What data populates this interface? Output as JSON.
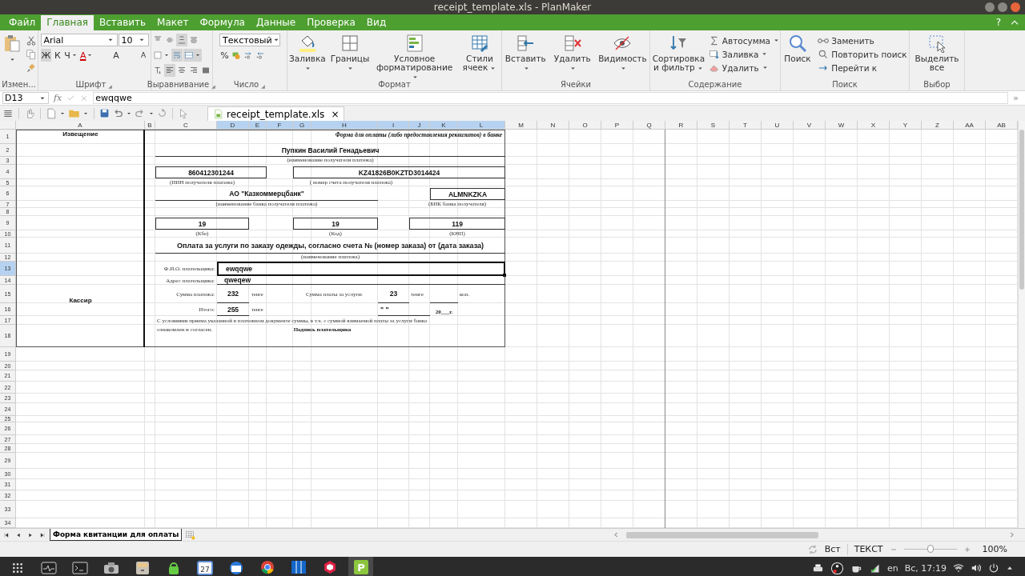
{
  "window": {
    "title": "receipt_template.xls - PlanMaker"
  },
  "menu_tabs": [
    {
      "label": "Файл",
      "selected": false
    },
    {
      "label": "Главная",
      "selected": true
    },
    {
      "label": "Вставить",
      "selected": false
    },
    {
      "label": "Макет",
      "selected": false
    },
    {
      "label": "Формула",
      "selected": false
    },
    {
      "label": "Данные",
      "selected": false
    },
    {
      "label": "Проверка",
      "selected": false
    },
    {
      "label": "Вид",
      "selected": false
    }
  ],
  "help_button": "?",
  "ribbon": [
    {
      "title": "Измен...",
      "launcher": false,
      "items": [
        {
          "kind": "large",
          "dropdown": true
        },
        {
          "kind": "stack",
          "items": [
            {
              "kind": "small",
              "dropdown": false
            },
            {
              "kind": "small",
              "dropdown": false
            },
            {
              "kind": "small",
              "dropdown": false
            }
          ]
        }
      ]
    },
    {
      "title": "Шрифт",
      "launcher": true,
      "top": [
        {
          "kind": "font-select",
          "value": "Arial"
        },
        {
          "kind": "size-select",
          "value": "10"
        }
      ],
      "bottom": [
        {
          "kind": "toggle",
          "label": "Ж",
          "selected": true,
          "dropdown": false
        },
        {
          "kind": "toggle",
          "label": "К",
          "selected": false,
          "dropdown": false
        },
        {
          "kind": "toggle",
          "label": "Ч",
          "selected": false,
          "dropdown": true
        },
        {
          "kind": "color",
          "label": "A",
          "selected": false,
          "dropdown": true
        },
        {
          "kind": "grow",
          "label": "A",
          "selected": false,
          "dropdown": false
        },
        {
          "kind": "shrink",
          "label": "A",
          "selected": false,
          "dropdown": false
        }
      ]
    },
    {
      "title": "Выравнивание",
      "launcher": true,
      "top": [
        {
          "kind": "icon",
          "selected": false,
          "dropdown": false
        },
        {
          "kind": "icon",
          "selected": false,
          "dropdown": false
        },
        {
          "kind": "icon",
          "selected": true,
          "dropdown": false
        },
        {
          "kind": "icon",
          "selected": false,
          "dropdown": false
        }
      ],
      "middle": [
        {
          "kind": "icon",
          "selected": false,
          "dropdown": true
        },
        {
          "kind": "icon",
          "selected": true,
          "dropdown": false
        },
        {
          "kind": "icon",
          "selected": true,
          "dropdown": true
        }
      ],
      "bottom": [
        {
          "kind": "icon",
          "selected": false,
          "dropdown": false
        },
        {
          "kind": "icon",
          "selected": true,
          "dropdown": false
        },
        {
          "kind": "icon",
          "selected": false,
          "dropdown": false
        },
        {
          "kind": "icon",
          "selected": false,
          "dropdown": false
        },
        {
          "kind": "icon",
          "selected": false,
          "dropdown": false
        }
      ]
    },
    {
      "title": "Число",
      "launcher": true,
      "top": [
        {
          "kind": "format-select",
          "value": "Текстовый"
        }
      ],
      "bottom": [
        {
          "kind": "toggle",
          "label": "%",
          "selected": false,
          "dropdown": false
        },
        {
          "kind": "icon",
          "selected": false,
          "dropdown": false
        },
        {
          "kind": "icon",
          "selected": false,
          "dropdown": false
        },
        {
          "kind": "icon",
          "selected": false,
          "dropdown": false
        }
      ]
    },
    {
      "title": "Формат",
      "launcher": false,
      "items": [
        {
          "kind": "large",
          "label": "Заливка",
          "dropdown": true
        },
        {
          "kind": "large",
          "label": "Границы",
          "dropdown": true
        },
        {
          "kind": "large",
          "label": "Условное форматирование",
          "dropdown": true
        },
        {
          "kind": "large",
          "label": "Стили ячеек",
          "dropdown": true
        }
      ]
    },
    {
      "title": "Ячейки",
      "launcher": false,
      "items": [
        {
          "kind": "large",
          "label": "Вставить",
          "dropdown": true
        },
        {
          "kind": "large",
          "label": "Удалить",
          "dropdown": true
        },
        {
          "kind": "large",
          "label": "Видимость",
          "dropdown": true
        }
      ]
    },
    {
      "title": "Содержание",
      "launcher": false,
      "items": [
        {
          "kind": "large",
          "label": "Сортировка и фильтр",
          "dropdown": true
        },
        {
          "kind": "stack",
          "items": [
            {
              "kind": "small",
              "label": "Автосумма",
              "dropdown": true
            },
            {
              "kind": "small",
              "label": "Заливка",
              "dropdown": true
            },
            {
              "kind": "small",
              "label": "Удалить",
              "dropdown": true
            }
          ]
        }
      ]
    },
    {
      "title": "Поиск",
      "launcher": false,
      "items": [
        {
          "kind": "large",
          "label": "Поиск",
          "dropdown": false
        },
        {
          "kind": "stack",
          "items": [
            {
              "kind": "small",
              "label": "Заменить",
              "dropdown": false
            },
            {
              "kind": "small",
              "label": "Повторить поиск",
              "dropdown": false
            },
            {
              "kind": "small",
              "label": "Перейти к",
              "dropdown": false
            }
          ]
        }
      ]
    },
    {
      "title": "Выбор",
      "launcher": false,
      "items": [
        {
          "kind": "large",
          "label": "Выделить все",
          "dropdown": false
        }
      ]
    }
  ],
  "formula_bar": {
    "cell_ref": "D13",
    "function_symbol": "fx",
    "value": "ewqqwe",
    "more": "»"
  },
  "document_tab": {
    "label": "receipt_template.xls",
    "close": "×"
  },
  "sheet": {
    "columns": [
      {
        "label": "A",
        "selected": false
      },
      {
        "label": "B",
        "selected": false
      },
      {
        "label": "C",
        "selected": false
      },
      {
        "label": "D",
        "selected": true
      },
      {
        "label": "E",
        "selected": true
      },
      {
        "label": "F",
        "selected": true
      },
      {
        "label": "G",
        "selected": true
      },
      {
        "label": "H",
        "selected": true
      },
      {
        "label": "I",
        "selected": true
      },
      {
        "label": "J",
        "selected": true
      },
      {
        "label": "K",
        "selected": true
      },
      {
        "label": "L",
        "selected": true
      },
      {
        "label": "M",
        "selected": false
      },
      {
        "label": "N",
        "selected": false
      },
      {
        "label": "O",
        "selected": false
      },
      {
        "label": "P",
        "selected": false
      },
      {
        "label": "Q",
        "selected": false
      },
      {
        "label": "R",
        "selected": false
      },
      {
        "label": "S",
        "selected": false
      },
      {
        "label": "T",
        "selected": false
      },
      {
        "label": "U",
        "selected": false
      },
      {
        "label": "V",
        "selected": false
      },
      {
        "label": "W",
        "selected": false
      },
      {
        "label": "X",
        "selected": false
      },
      {
        "label": "Y",
        "selected": false
      },
      {
        "label": "Z",
        "selected": false
      },
      {
        "label": "AA",
        "selected": false
      },
      {
        "label": "AB",
        "selected": false
      }
    ],
    "rows": [
      {
        "label": "1",
        "selected": false
      },
      {
        "label": "2",
        "selected": false
      },
      {
        "label": "3",
        "selected": false
      },
      {
        "label": "4",
        "selected": false
      },
      {
        "label": "5",
        "selected": false
      },
      {
        "label": "6",
        "selected": false
      },
      {
        "label": "7",
        "selected": false
      },
      {
        "label": "8",
        "selected": false
      },
      {
        "label": "9",
        "selected": false
      },
      {
        "label": "10",
        "selected": false
      },
      {
        "label": "11",
        "selected": false
      },
      {
        "label": "12",
        "selected": false
      },
      {
        "label": "13",
        "selected": true
      },
      {
        "label": "14",
        "selected": false
      },
      {
        "label": "15",
        "selected": false
      },
      {
        "label": "16",
        "selected": false
      },
      {
        "label": "17",
        "selected": false
      },
      {
        "label": "18",
        "selected": false
      },
      {
        "label": "19",
        "selected": false
      },
      {
        "label": "20",
        "selected": false
      },
      {
        "label": "21",
        "selected": false
      },
      {
        "label": "22",
        "selected": false
      },
      {
        "label": "23",
        "selected": false
      },
      {
        "label": "24",
        "selected": false
      },
      {
        "label": "25",
        "selected": false
      },
      {
        "label": "26",
        "selected": false
      },
      {
        "label": "27",
        "selected": false
      },
      {
        "label": "28",
        "selected": false
      },
      {
        "label": "29",
        "selected": false
      },
      {
        "label": "30",
        "selected": false
      },
      {
        "label": "31",
        "selected": false
      },
      {
        "label": "32",
        "selected": false
      },
      {
        "label": "33",
        "selected": false
      },
      {
        "label": "34",
        "selected": false
      }
    ],
    "receipt": {
      "notice": "Извещение",
      "cashier": "Кассир",
      "form_note": "Форма для оплаты (либо предоставления реквизитов) в банке",
      "recipient": {
        "value": "Пупкин Василий Генадьевич",
        "caption": "(наименование получателя платежа)"
      },
      "iin": {
        "value": "860412301244",
        "caption": "(ИИН получателя платежа)"
      },
      "account": {
        "value": "KZ41826B0KZTD3014424",
        "caption": "( номер счета получателя платежа)"
      },
      "bank": {
        "value": "АО \"Казкоммерцбанк\"",
        "caption": "(наименование банка получателя платежа)"
      },
      "bik": {
        "value": "ALMNKZKA",
        "caption": "(БИК банка получателя)"
      },
      "kbe": {
        "value": "19",
        "caption": "(Кбе)"
      },
      "kod": {
        "value": "19",
        "caption": "(Код)"
      },
      "knp": {
        "value": "119",
        "caption": "(КНП)"
      },
      "purpose": {
        "value": "Оплата за услуги по заказу одежды, согласно счета № (номер заказа) от (дата заказа)",
        "caption": "(наименование платежа)"
      },
      "payer_name": {
        "label": "Ф.И.О. плательщика:",
        "value": "ewqqwe",
        "selected": true
      },
      "payer_address": {
        "label": "Адрес плательщика:",
        "value": "qweqew"
      },
      "amount": {
        "label": "Сумма платежа:",
        "value": "232",
        "unit": "тенге"
      },
      "fee": {
        "label": "Сумма платы за услуги:",
        "value": "23",
        "unit": "тенге",
        "kopeck_unit": "коп."
      },
      "total": {
        "label": "Итого:",
        "value": "255",
        "unit": "тенге"
      },
      "date_quotes": "\"   \"",
      "year": "20___г.",
      "terms": "С условиями приема указанной в платежном документе суммы, в т.ч. с суммой взимаемой платы за услуги банка",
      "terms_end": "ознакомлен и согласен.",
      "signature": "Подпись плательщика"
    }
  },
  "sheet_tabs": [
    {
      "label": "Форма квитанции для оплаты",
      "selected": true
    }
  ],
  "status_bar": {
    "mode": "Вст",
    "format": "ТЕКСТ",
    "zoom": {
      "level": 0.5,
      "reading": "100%"
    }
  },
  "taskbar": {
    "apps": [
      {
        "running": false,
        "selected": false
      },
      {
        "running": false,
        "selected": false
      },
      {
        "running": false,
        "selected": false
      },
      {
        "running": false,
        "selected": false
      },
      {
        "running": false,
        "selected": false
      },
      {
        "running": false,
        "selected": false
      },
      {
        "running": false,
        "selected": false,
        "label": "27"
      },
      {
        "running": false,
        "selected": false
      },
      {
        "running": true,
        "selected": false
      },
      {
        "running": true,
        "selected": false
      },
      {
        "running": true,
        "selected": false
      },
      {
        "running": true,
        "selected": true,
        "label": "P"
      }
    ],
    "keyboard": "en",
    "clock": "Вс, 17:19"
  }
}
